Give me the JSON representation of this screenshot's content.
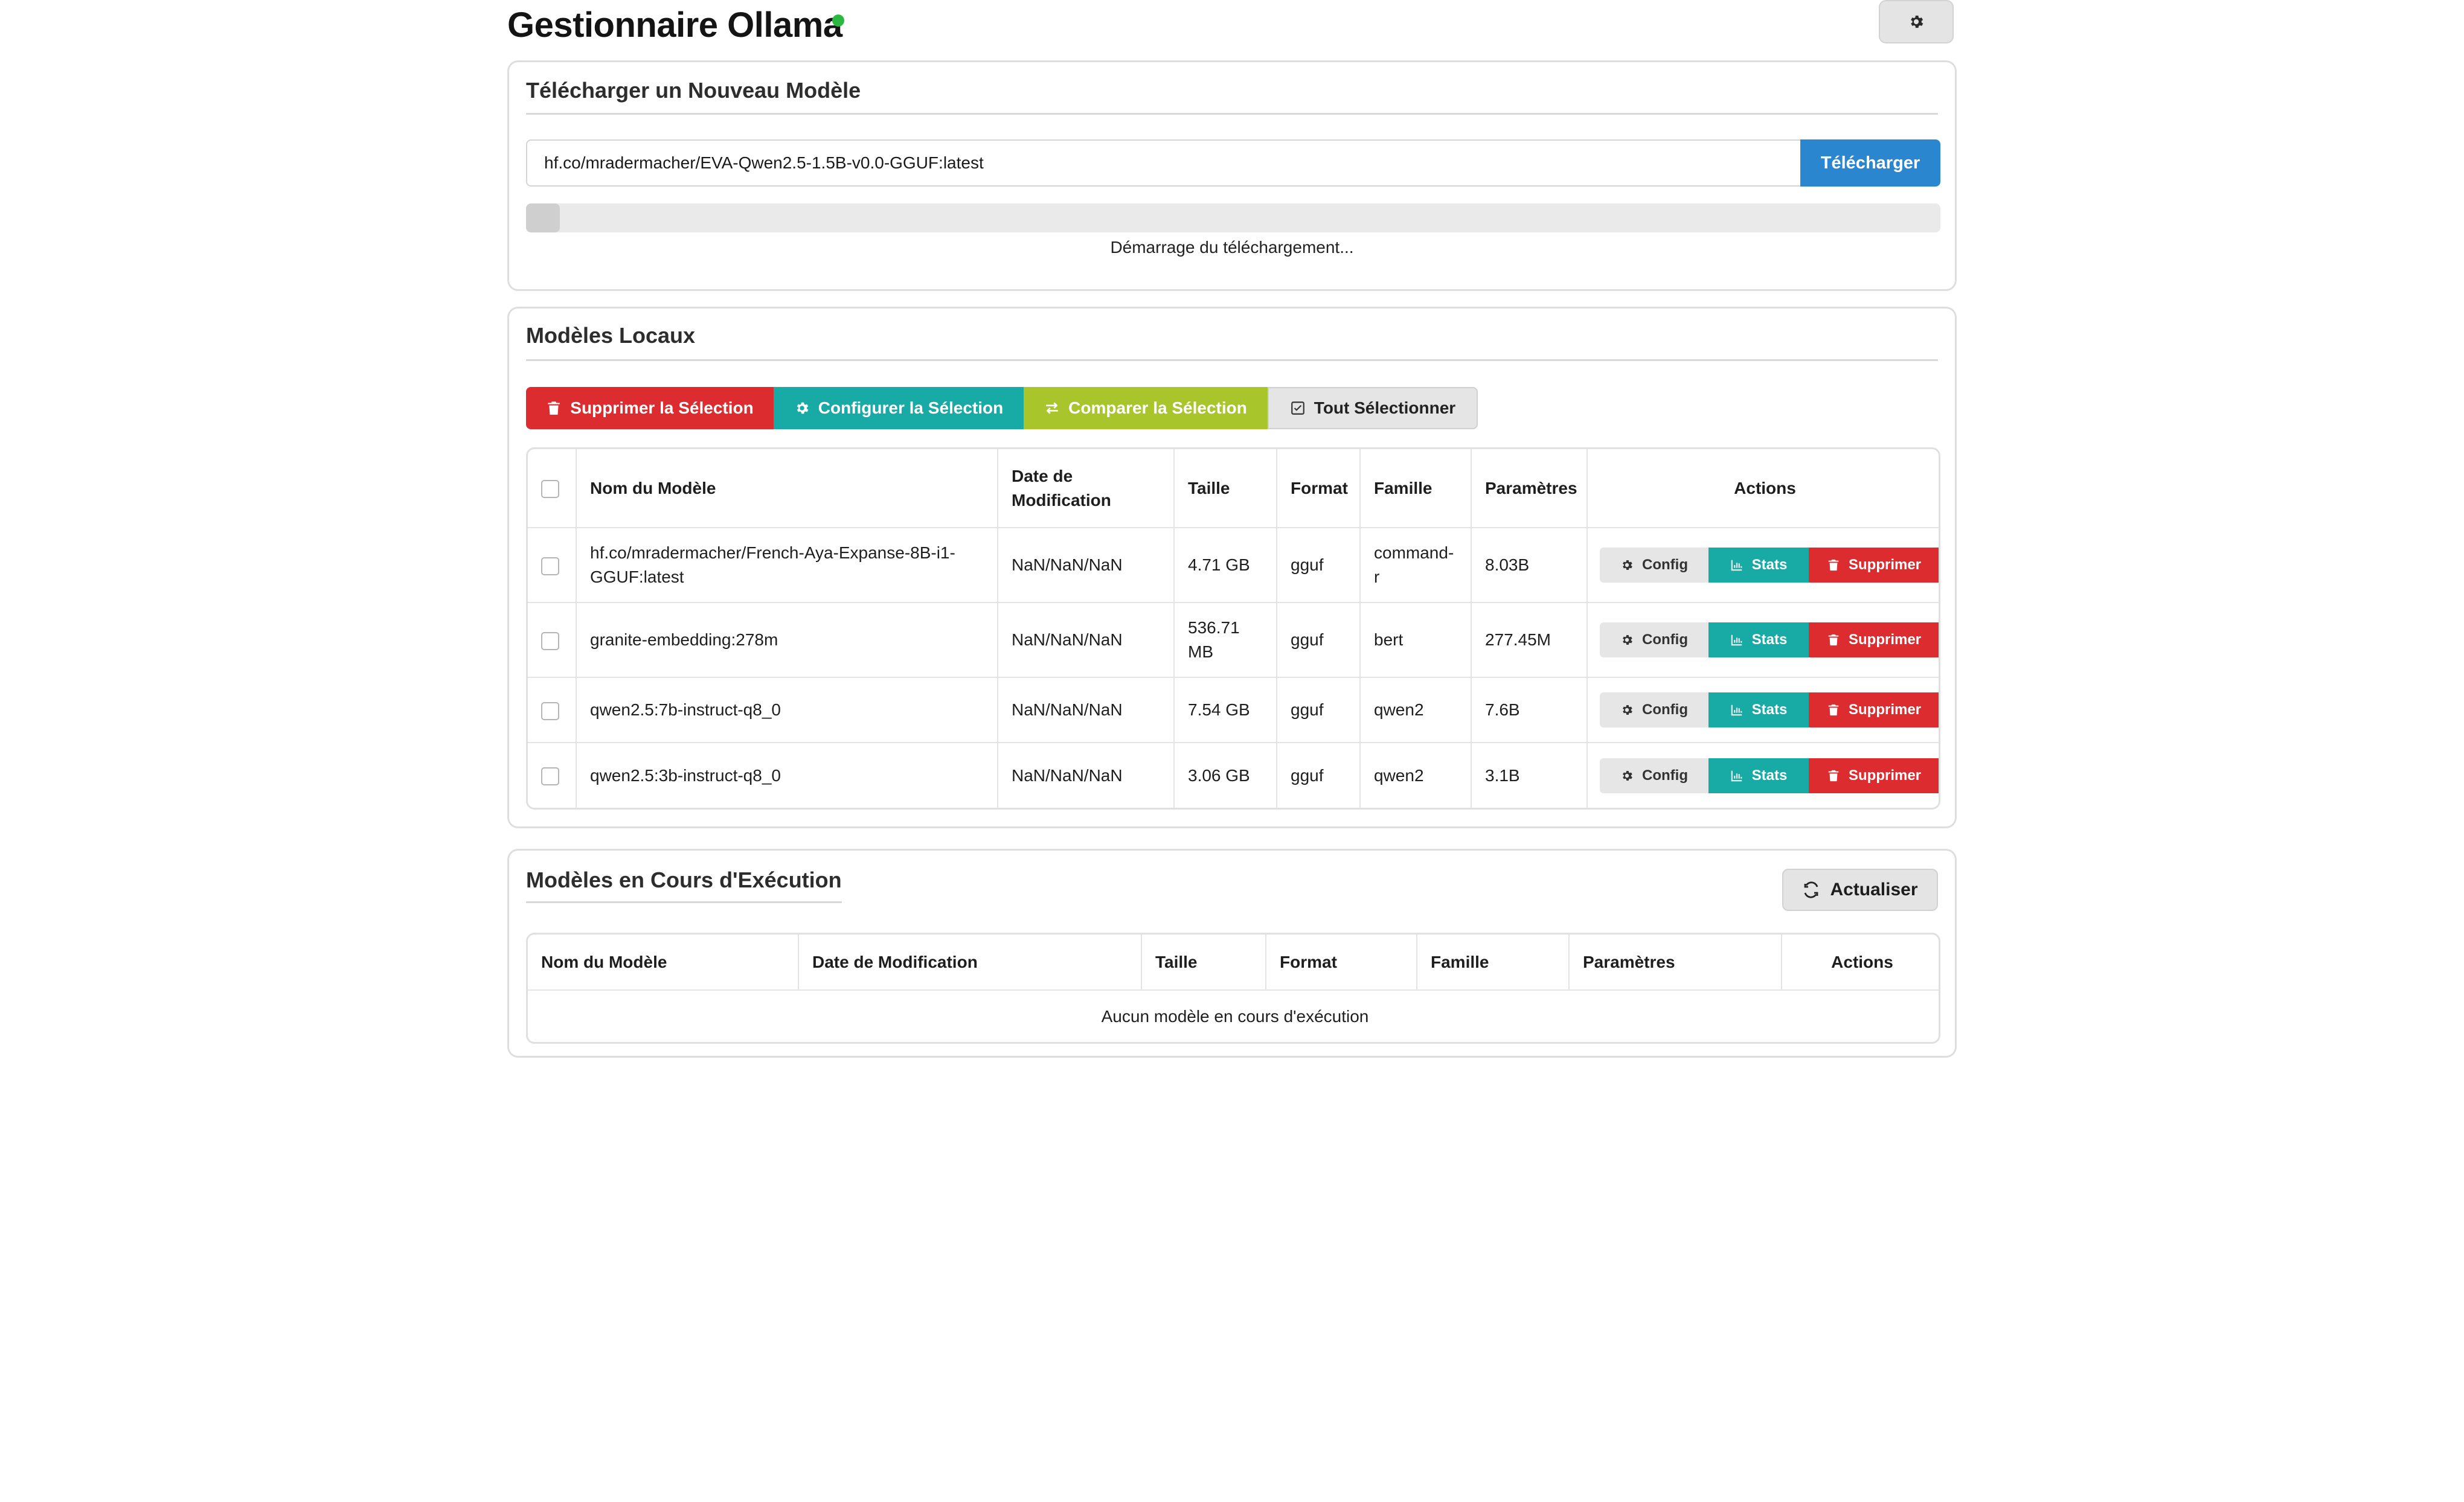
{
  "app": {
    "title": "Gestionnaire Ollama",
    "status_color": "#2ab843",
    "settings_icon": "gear-icon"
  },
  "download": {
    "title": "Télécharger un Nouveau Modèle",
    "input_value": "hf.co/mradermacher/EVA-Qwen2.5-1.5B-v0.0-GGUF:latest",
    "button_label": "Télécharger",
    "progress_fraction": 0.01,
    "status_text": "Démarrage du téléchargement..."
  },
  "local": {
    "title": "Modèles Locaux",
    "bulk": {
      "delete_label": "Supprimer la Sélection",
      "configure_label": "Configurer la Sélection",
      "compare_label": "Comparer la Sélection",
      "select_all_label": "Tout Sélectionner"
    },
    "columns": [
      "Nom du Modèle",
      "Date de Modification",
      "Taille",
      "Format",
      "Famille",
      "Paramètres",
      "Actions"
    ],
    "rows": [
      {
        "name": "hf.co/mradermacher/French-Aya-Expanse-8B-i1-GGUF:latest",
        "date": "NaN/NaN/NaN",
        "size": "4.71 GB",
        "format": "gguf",
        "family": "command-r",
        "params": "8.03B"
      },
      {
        "name": "granite-embedding:278m",
        "date": "NaN/NaN/NaN",
        "size": "536.71 MB",
        "format": "gguf",
        "family": "bert",
        "params": "277.45M"
      },
      {
        "name": "qwen2.5:7b-instruct-q8_0",
        "date": "NaN/NaN/NaN",
        "size": "7.54 GB",
        "format": "gguf",
        "family": "qwen2",
        "params": "7.6B"
      },
      {
        "name": "qwen2.5:3b-instruct-q8_0",
        "date": "NaN/NaN/NaN",
        "size": "3.06 GB",
        "format": "gguf",
        "family": "qwen2",
        "params": "3.1B"
      }
    ],
    "row_actions": {
      "config_label": "Config",
      "stats_label": "Stats",
      "delete_label": "Supprimer"
    }
  },
  "running": {
    "title": "Modèles en Cours d'Exécution",
    "refresh_label": "Actualiser",
    "columns": [
      "Nom du Modèle",
      "Date de Modification",
      "Taille",
      "Format",
      "Famille",
      "Paramètres",
      "Actions"
    ],
    "empty_text": "Aucun modèle en cours d'exécution"
  },
  "colors": {
    "primary": "#2b86d0",
    "danger": "#dd2c2f",
    "teal": "#18aaa5",
    "lime": "#a9c52c"
  }
}
